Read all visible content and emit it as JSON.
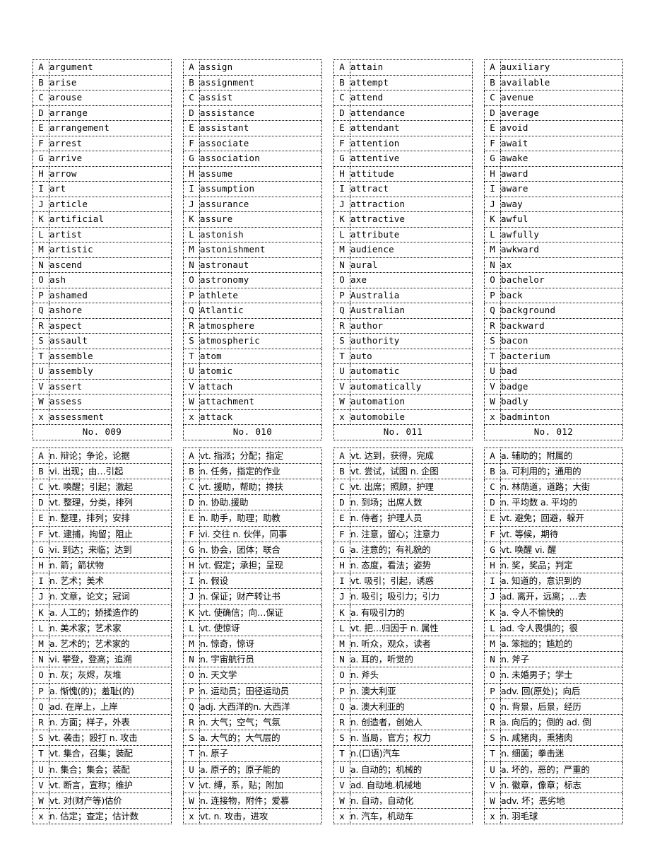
{
  "document": {
    "title": "English vocabulary list No.009 - No.012",
    "row_keys": [
      "A",
      "B",
      "C",
      "D",
      "E",
      "F",
      "G",
      "H",
      "I",
      "J",
      "K",
      "L",
      "M",
      "N",
      "O",
      "P",
      "Q",
      "R",
      "S",
      "T",
      "U",
      "V",
      "W",
      "x"
    ]
  },
  "groups": [
    {
      "no_label": "No. 009",
      "words": [
        "argument",
        "arise",
        "arouse",
        "arrange",
        "arrangement",
        "arrest",
        "arrive",
        "arrow",
        "art",
        "article",
        "artificial",
        "artist",
        "artistic",
        "ascend",
        "ash",
        "ashamed",
        "ashore",
        "aspect",
        "assault",
        "assemble",
        "assembly",
        "assert",
        "assess",
        "assessment"
      ],
      "defs": [
        "n. 辩论；争论，论据",
        "vi. 出现；由…引起",
        "vt. 唤醒；引起；激起",
        "vt. 整理，分类，排列",
        "n. 整理，排列；安排",
        "vt. 逮捕，拘留；阻止",
        "vi. 到达；来临；达到",
        "n. 箭；箭状物",
        "n. 艺术；美术",
        "n. 文章，论文；冠词",
        "a. 人工的；娇揉造作的",
        "n. 美术家；艺术家",
        "a. 艺术的；艺术家的",
        "vi. 攀登，登高；追溯",
        "n. 灰；灰烬，灰堆",
        "a. 惭愧(的)；羞耻(的)",
        "ad. 在岸上，上岸",
        "n. 方面；样子，外表",
        "vt. 袭击；殴打 n. 攻击",
        "vt. 集合，召集；装配",
        " n. 集合；集会；装配",
        "  vt. 断言，宣称；维护",
        "  vt. 对(财产等)估价",
        "n. 估定；查定；估计数"
      ]
    },
    {
      "no_label": "No. 010",
      "words": [
        "assign",
        "assignment",
        "assist",
        "assistance",
        "assistant",
        "associate",
        "association",
        "assume",
        "assumption",
        "assurance",
        "assure",
        "astonish",
        "astonishment",
        "astronaut",
        "astronomy",
        "athlete",
        "Atlantic",
        "atmosphere",
        "atmospheric",
        "atom",
        "atomic",
        "attach",
        "attachment",
        "attack"
      ],
      "defs": [
        "vt. 指派；分配；指定",
        "n. 任务，指定的作业",
        "vt. 援助，帮助；搀扶",
        "n. 协助.援助",
        "n. 助手，助理；助教",
        "vi. 交往 n. 伙伴，同事",
        "n. 协会，团体；联合",
        "vt. 假定；承担；呈现",
        "n. 假设",
        "n. 保证；财产转让书",
        "vt. 使确信；向…保证",
        "vt. 使惊讶",
        "n. 惊奇，惊讶",
        "n. 宇宙航行员",
        "n. 天文学",
        "n. 运动员；田径运动员",
        "adj. 大西洋的n. 大西洋",
        "n. 大气；空气；气氛",
        "a. 大气的；大气层的",
        "n. 原子",
        "a. 原子的；原子能的",
        "vt. 缚，系，贴；附加",
        "n. 连接物，附件；爱慕",
        "vt. n. 攻击，进攻"
      ]
    },
    {
      "no_label": "No. 011",
      "words": [
        "attain",
        "attempt",
        "attend",
        "attendance",
        "attendant",
        "attention",
        "attentive",
        "attitude",
        "attract",
        "attraction",
        "attractive",
        "attribute",
        "audience",
        "aural",
        "axe",
        "Australia",
        "Australian",
        "author",
        "authority",
        "auto",
        "automatic",
        "automatically",
        "automation",
        "automobile"
      ],
      "defs": [
        "vt. 达到，获得，完成",
        "vt. 尝试，试图 n. 企图",
        "vt. 出席；照顾，护理",
        "n. 到场；出席人数",
        "n. 侍者；护理人员",
        "n. 注意，留心；注意力",
        "a. 注意的；有礼貌的",
        "n. 态度，看法；姿势",
        "vt. 吸引；引起，诱惑",
        "n. 吸引；吸引力；引力",
        "a. 有吸引力的",
        "vt. 把…归因于 n. 属性",
        "n. 听众，观众，读者",
        "a. 耳的，听觉的",
        "n. 斧头",
        "n. 澳大利亚",
        "a. 澳大利亚的",
        "n. 创造者，创始人",
        "n. 当局，官方；权力",
        "n.(口语)汽车",
        "a. 自动的；机械的",
        "ad. 自动地.机械地",
        "n. 自动，自动化",
        "n. 汽车，机动车"
      ]
    },
    {
      "no_label": "No. 012",
      "words": [
        "auxiliary",
        "available",
        "avenue",
        "average",
        "avoid",
        "await",
        "awake",
        "award",
        "aware",
        "away",
        "awful",
        "awfully",
        "awkward",
        "ax",
        "bachelor",
        "back",
        "background",
        "backward",
        "bacon",
        "bacterium",
        "bad",
        "badge",
        "badly",
        "badminton"
      ],
      "defs": [
        "a. 辅助的；附属的",
        "a. 可利用的；通用的",
        "n. 林荫道，道路；大街",
        "n. 平均数 a. 平均的",
        "vt. 避免；回避，躲开",
        "vt. 等候，期待",
        "vt. 唤醒 vi. 醒",
        "n. 奖，奖品；判定",
        "a. 知道的，意识到的",
        "ad. 离开，远离；…去",
        "a. 令人不愉快的",
        "ad. 令人畏惧的；很",
        "a. 笨拙的；尴尬的",
        "n. 斧子",
        "n. 未婚男子；学士",
        "adv. 回(原处)；向后",
        "n. 背景，后景，经历",
        "a. 向后的；倒的 ad. 倒",
        "n. 咸猪肉，熏猪肉",
        "n. 细菌；拳击迷",
        "a. 坏的，恶的；严重的",
        "n. 徽章，像章；标志",
        "adv. 坏；恶劣地",
        "n. 羽毛球"
      ]
    }
  ]
}
